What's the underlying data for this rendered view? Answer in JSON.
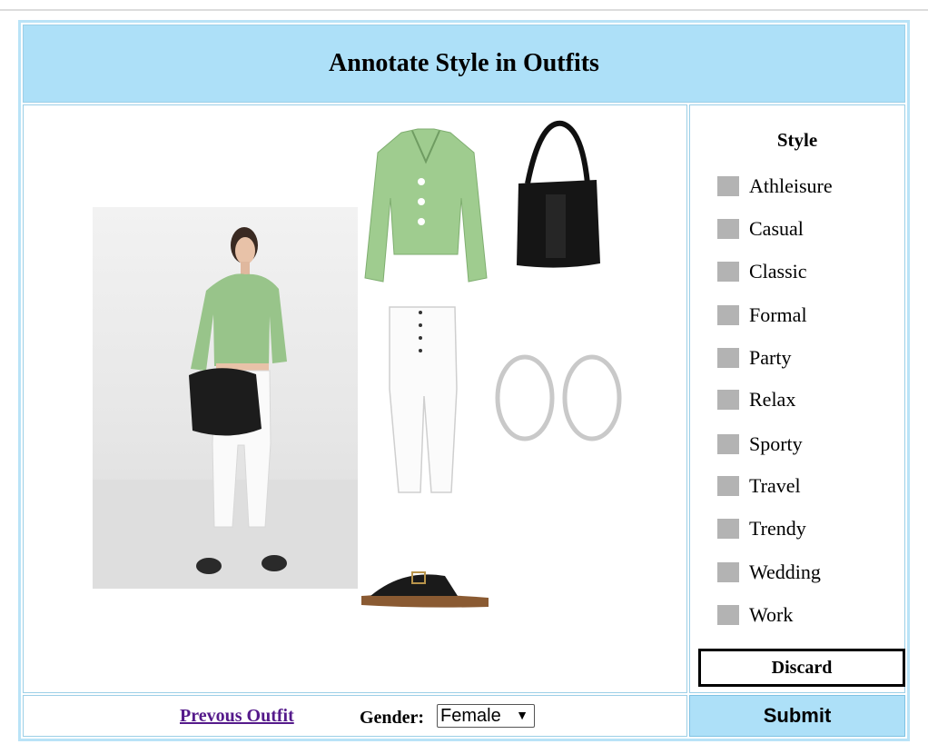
{
  "header": {
    "title": "Annotate Style in Outfits"
  },
  "style_panel": {
    "title": "Style",
    "options": [
      "Athleisure",
      "Casual",
      "Classic",
      "Formal",
      "Party",
      "Relax",
      "Sporty",
      "Travel",
      "Trendy",
      "Wedding",
      "Work"
    ],
    "discard_label": "Discard"
  },
  "footer": {
    "prev_link": "Prevous Outfit",
    "gender_label": "Gender:",
    "gender_value": "Female",
    "submit_label": "Submit"
  },
  "outfit_items": [
    "model-photo",
    "green-cropped-shirt",
    "black-hobo-bag",
    "white-jeans",
    "silver-hoop-earrings",
    "black-slide-sandals"
  ],
  "colors": {
    "header_bg": "#ade0f8",
    "link": "#551a8b",
    "checkbox": "#b3b3b3"
  }
}
